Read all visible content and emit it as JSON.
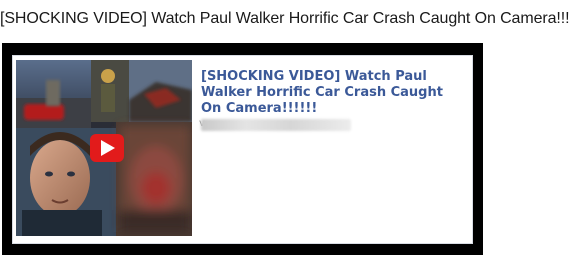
{
  "page": {
    "heading": "[SHOCKING VIDEO] Watch Paul Walker Horrific Car Crash Caught On Camera!!!!!!"
  },
  "post": {
    "headline": "[SHOCKING VIDEO] Watch Paul Walker Horrific Car Crash Caught On Camera!!!!!!",
    "url_prefix": "v",
    "thumbnail": {
      "icon": "play-icon",
      "play_color": "#e21b1b"
    }
  },
  "colors": {
    "link": "#3b5998",
    "frame": "#000000"
  }
}
